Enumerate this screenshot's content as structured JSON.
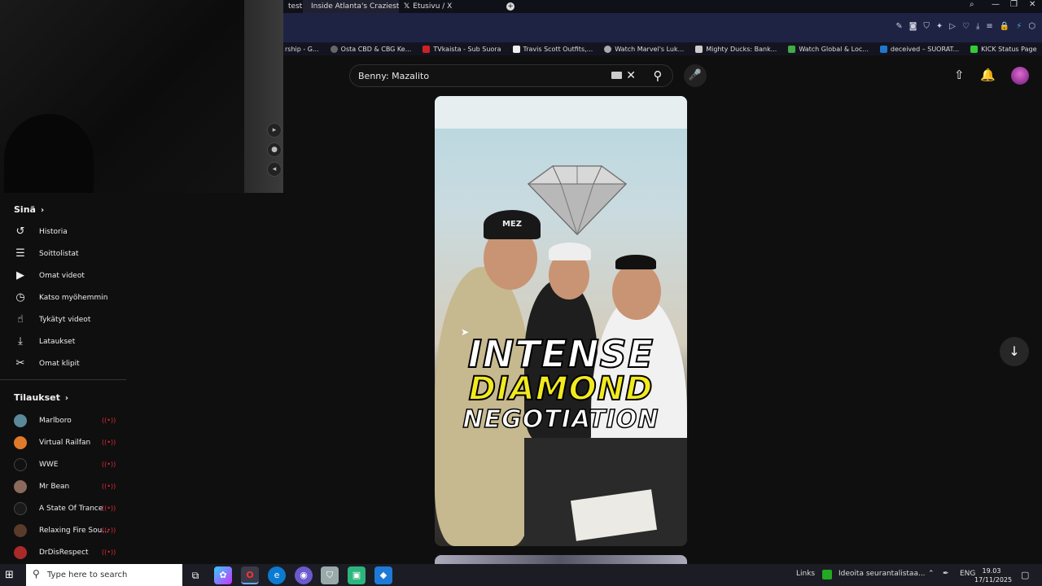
{
  "browser": {
    "tabs": [
      {
        "label": "test"
      },
      {
        "label": "Inside Atlanta's Craziest Je"
      },
      {
        "label": "Etusivu / X"
      }
    ],
    "new_tab_icon": "plus-icon",
    "bookmarks": [
      {
        "label": "rship - G..."
      },
      {
        "label": "Osta CBD & CBG Ke..."
      },
      {
        "label": "TVkaista - Sub Suora"
      },
      {
        "label": "Travis Scott Outfits,..."
      },
      {
        "label": "Watch Marvel's Luk..."
      },
      {
        "label": "Mighty Ducks: Bank..."
      },
      {
        "label": "Watch Global & Loc..."
      },
      {
        "label": "deceived – SUORAT..."
      },
      {
        "label": "KICK Status Page"
      }
    ]
  },
  "header": {
    "search_value": "Benny: Mazalito",
    "clear_icon": "close-icon",
    "search_icon": "search-icon",
    "mic_icon": "mic-icon",
    "upload_icon": "upload-icon",
    "bell_icon": "bell-icon"
  },
  "sidebar": {
    "you_title": "Sinä",
    "you_items": [
      {
        "label": "Historia",
        "icon": "history-icon",
        "glyph": "↺"
      },
      {
        "label": "Soittolistat",
        "icon": "playlist-icon",
        "glyph": "☰"
      },
      {
        "label": "Omat videot",
        "icon": "video-icon",
        "glyph": "▶"
      },
      {
        "label": "Katso myöhemmin",
        "icon": "clock-icon",
        "glyph": "◷"
      },
      {
        "label": "Tykätyt videot",
        "icon": "thumbs-up-icon",
        "glyph": "👍"
      },
      {
        "label": "Lataukset",
        "icon": "download-icon",
        "glyph": "⤓"
      },
      {
        "label": "Omat klipit",
        "icon": "scissors-icon",
        "glyph": "✂"
      }
    ],
    "subs_title": "Tilaukset",
    "subscriptions": [
      {
        "label": "Marlboro",
        "color": "#5a8a9a"
      },
      {
        "label": "Virtual Railfan",
        "color": "#e07a2a"
      },
      {
        "label": "WWE",
        "color": "#111111"
      },
      {
        "label": "Mr Bean",
        "color": "#8a6a5a"
      },
      {
        "label": "A State Of Trance",
        "color": "#1a1a1a"
      },
      {
        "label": "Relaxing Fire Sou...",
        "color": "#5a3a2a"
      },
      {
        "label": "DrDisRespect",
        "color": "#aa2a2a"
      }
    ],
    "live_icon": "live-icon"
  },
  "video": {
    "line1": "INTENSE",
    "line2": "DIAMOND",
    "line3": "NEGOTIATION",
    "cap_text": "MEZ"
  },
  "taskbar": {
    "search_placeholder": "Type here to search",
    "links": "Links",
    "notification": "Ideoita seurantalistaa...",
    "lang": "ENG",
    "time": "19.03",
    "date": "17/11/2025"
  }
}
